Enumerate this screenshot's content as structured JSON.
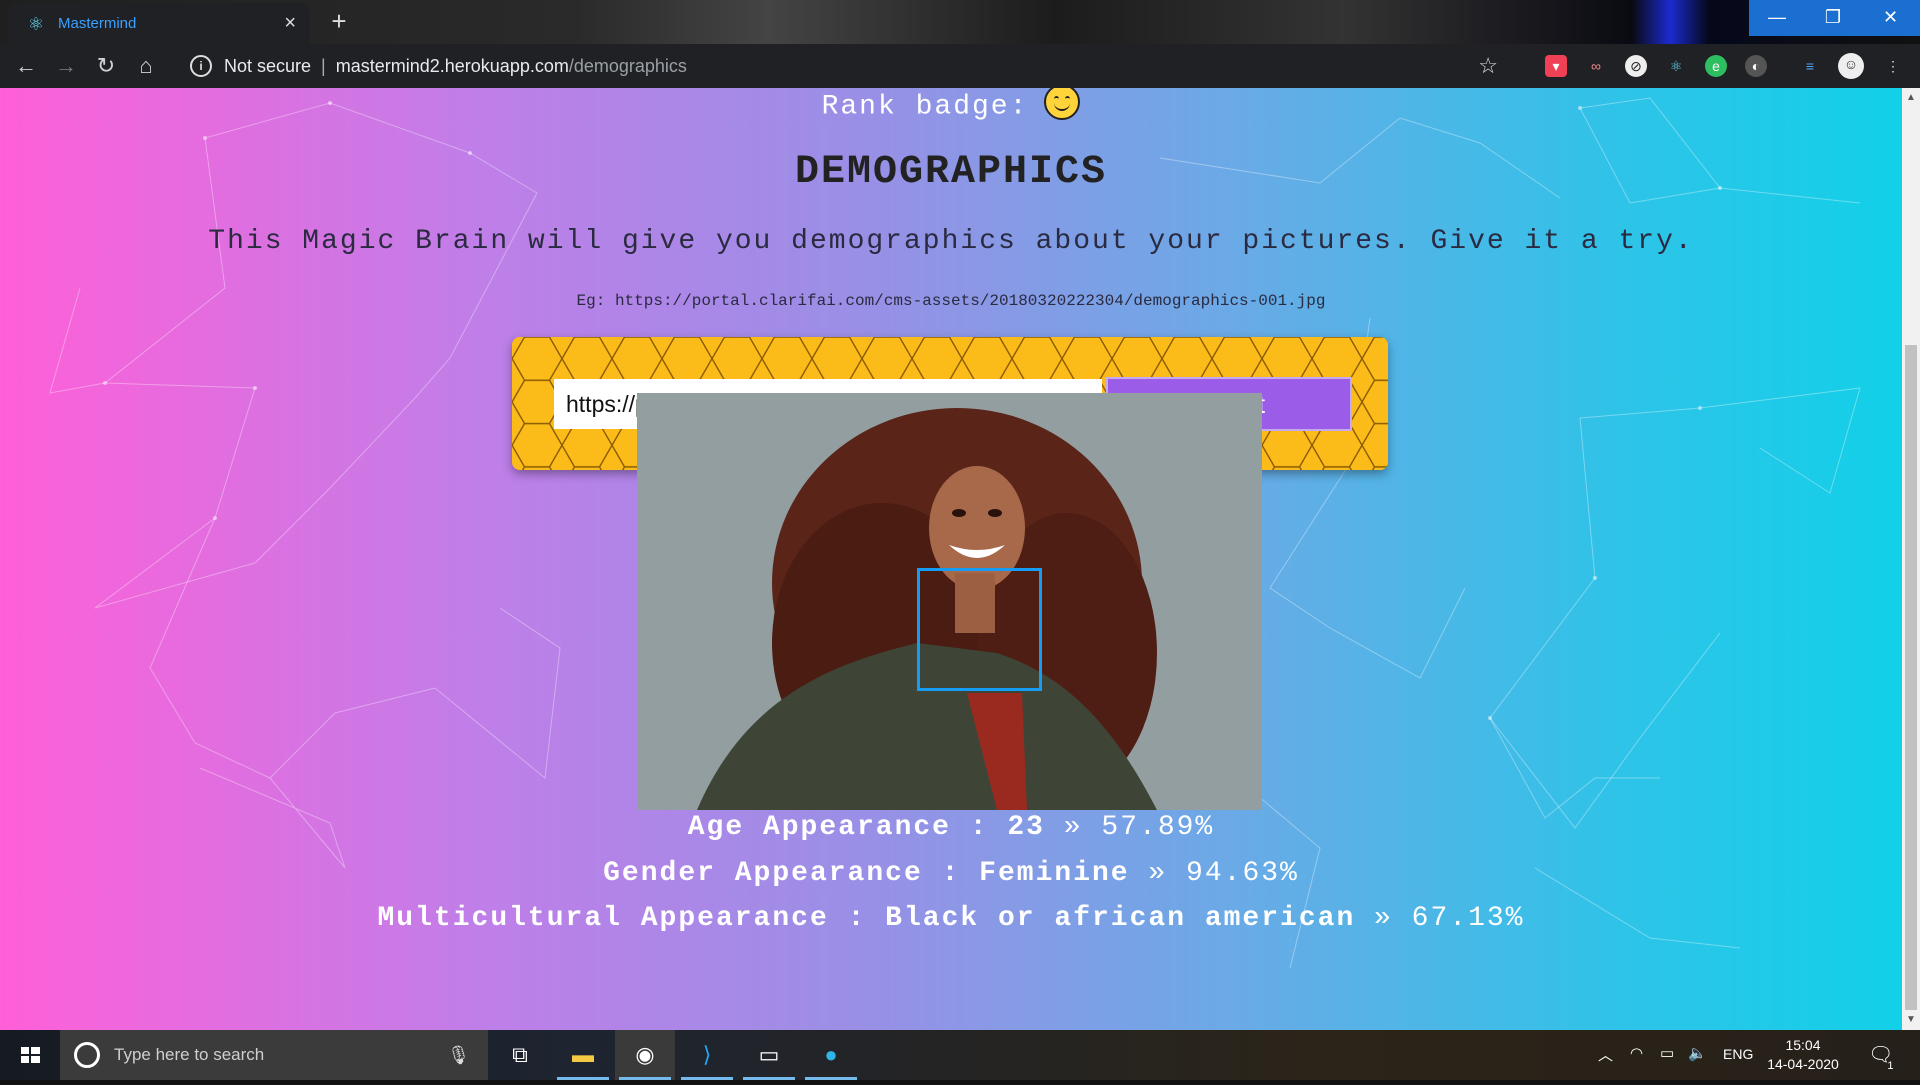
{
  "browser": {
    "tab_title": "Mastermind",
    "tab_close": "×",
    "new_tab": "+",
    "security_label": "Not secure",
    "separator": "|",
    "url_host": "mastermind2.herokuapp.com",
    "url_path": "/demographics",
    "window_controls": {
      "minimize": "—",
      "restore": "❐",
      "close": "✕"
    },
    "extensions": [
      "pocket-icon",
      "glasses-icon",
      "circle-slash-icon",
      "react-icon",
      "evernote-icon",
      "moon-icon",
      "reading-list-icon",
      "profile-avatar"
    ]
  },
  "page": {
    "rank_label": "Rank badge:",
    "heading": "DEMOGRAPHICS",
    "tagline": "This Magic Brain will give you demographics about your pictures. Give it a try.",
    "example": "Eg: https://portal.clarifai.com/cms-assets/20180320222304/demographics-001.jpg",
    "input_value": "https://portal.clarifai.com/cms-assets/20180320222304/demographics-001.jpg",
    "detect_label": "Detect",
    "results": {
      "age": {
        "label": "Age Appearance : 23",
        "sep": " » ",
        "pct": "57.89%"
      },
      "gender": {
        "label": "Gender Appearance : Feminine",
        "sep": " » ",
        "pct": "94.63%"
      },
      "culture": {
        "label": "Multicultural Appearance : Black or african american",
        "sep": " » ",
        "pct": "67.13%"
      }
    }
  },
  "taskbar": {
    "search_placeholder": "Type here to search",
    "language": "ENG",
    "time": "15:04",
    "date": "14-04-2020",
    "notification_count": "1"
  },
  "colors": {
    "accent_detect": "#9b5ce8",
    "honeycomb": "#fbbc1a",
    "face_box": "#149df2"
  }
}
